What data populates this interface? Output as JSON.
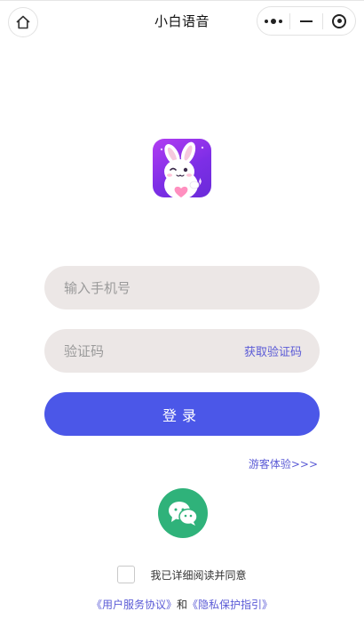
{
  "nav": {
    "title": "小白语音",
    "home_icon": "home-icon",
    "capsule_icons": [
      "more-dots-icon",
      "minimize-icon",
      "target-close-icon"
    ]
  },
  "logo": {
    "icon": "bunny-mascot-logo",
    "bg_color": "#8a31e9"
  },
  "form": {
    "phone": {
      "placeholder": "输入手机号",
      "value": ""
    },
    "code": {
      "placeholder": "验证码",
      "value": ""
    },
    "get_code_label": "获取验证码",
    "login_label": "登录",
    "guest_label": "游客体验>>>"
  },
  "wechat": {
    "icon": "wechat-icon",
    "color": "#2fb27a"
  },
  "agreement": {
    "checked": false,
    "text": "我已详细阅读并同意",
    "user_agreement": "《用户服务协议》",
    "conjunction": "和",
    "privacy_policy": "《隐私保护指引》"
  },
  "colors": {
    "accent": "#4b57e8",
    "link": "#5b5bd6",
    "input_bg": "#ece7e6"
  }
}
